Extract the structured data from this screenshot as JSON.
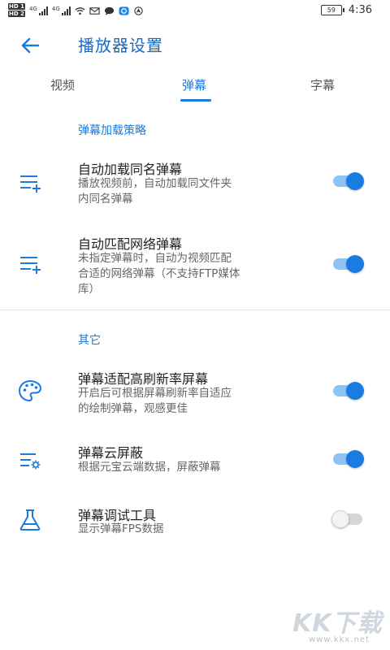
{
  "status_bar": {
    "hd1": "HD 1",
    "hd2": "HD 2",
    "net1": "4G",
    "net2": "4G",
    "battery": "59",
    "time": "4:36"
  },
  "header": {
    "title": "播放器设置"
  },
  "tabs": [
    {
      "label": "视频",
      "active": false
    },
    {
      "label": "弹幕",
      "active": true
    },
    {
      "label": "字幕",
      "active": false
    }
  ],
  "sections": [
    {
      "title": "弹幕加载策略",
      "items": [
        {
          "title": "自动加载同名弹幕",
          "desc_lines": [
            "播放视频前，自动加载同文件夹",
            "内同名弹幕"
          ],
          "icon": "playlist-add-icon",
          "enabled": true
        },
        {
          "title": "自动匹配网络弹幕",
          "desc_lines": [
            "未指定弹幕时，自动为视频匹配",
            "合适的网络弹幕（不支持FTP媒体",
            "库）"
          ],
          "icon": "playlist-add-icon",
          "enabled": true
        }
      ]
    },
    {
      "title": "其它",
      "items": [
        {
          "title": "弹幕适配高刷新率屏幕",
          "desc_lines": [
            "开启后可根据屏幕刷新率自适应",
            "的绘制弹幕，观感更佳"
          ],
          "icon": "palette-icon",
          "enabled": true
        },
        {
          "title": "弹幕云屏蔽",
          "desc_lines": [
            "根据元宝云端数据，屏蔽弹幕"
          ],
          "icon": "list-settings-icon",
          "enabled": true
        },
        {
          "title": "弹幕调试工具",
          "desc_lines": [
            "显示弹幕FPS数据"
          ],
          "icon": "flask-icon",
          "enabled": false
        }
      ]
    }
  ],
  "watermark": {
    "logo": "KK下载",
    "url": "www.kkx.net"
  },
  "colors": {
    "accent": "#1a7be0",
    "title": "#1769c4",
    "switch_track_on": "#8fc3f5",
    "switch_off": "#d6d6d6"
  }
}
